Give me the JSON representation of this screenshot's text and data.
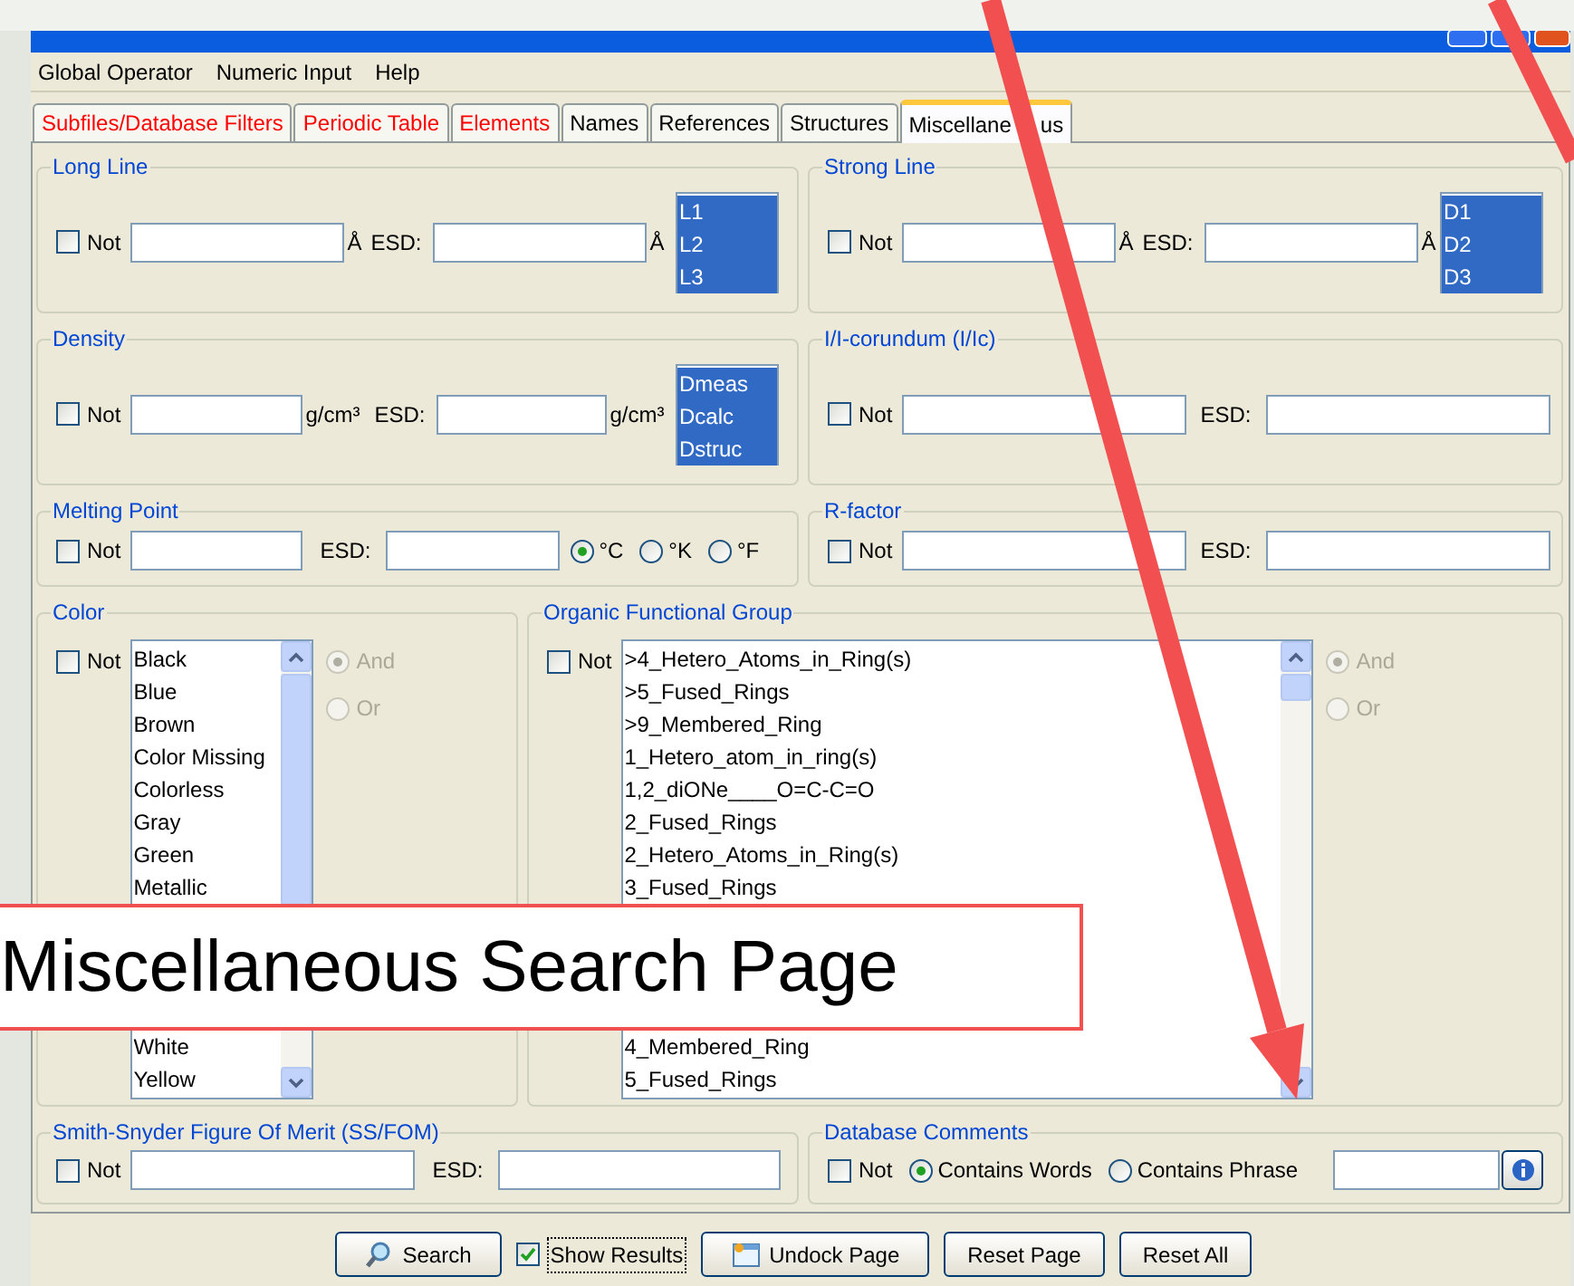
{
  "menu": [
    "Global Operator",
    "Numeric Input",
    "Help"
  ],
  "tabs": [
    {
      "label": "Subfiles/Database Filters",
      "selected": false,
      "flagged": true
    },
    {
      "label": "Periodic Table",
      "selected": false,
      "flagged": true
    },
    {
      "label": "Elements",
      "selected": false,
      "flagged": true
    },
    {
      "label": "Names",
      "selected": false,
      "flagged": false
    },
    {
      "label": "References",
      "selected": false,
      "flagged": false
    },
    {
      "label": "Structures",
      "selected": false,
      "flagged": false
    },
    {
      "label": "Miscellane",
      "label_after_cover": "us",
      "selected": true,
      "flagged": false
    }
  ],
  "long_line": {
    "title": "Long Line",
    "not": {
      "label": "Not",
      "checked": false
    },
    "unit": "Å",
    "esd_label": "ESD:",
    "esd_unit": "Å",
    "options": [
      {
        "label": "L1",
        "selected": true
      },
      {
        "label": "L2",
        "selected": true
      },
      {
        "label": "L3",
        "selected": true
      }
    ]
  },
  "strong_line": {
    "title": "Strong Line",
    "not": {
      "label": "Not",
      "checked": false
    },
    "unit": "Å",
    "esd_label": "ESD:",
    "esd_unit": "Å",
    "options": [
      {
        "label": "D1",
        "selected": true
      },
      {
        "label": "D2",
        "selected": true
      },
      {
        "label": "D3",
        "selected": true
      }
    ]
  },
  "density": {
    "title": "Density",
    "not": {
      "label": "Not",
      "checked": false
    },
    "unit": "g/cm³",
    "esd_label": "ESD:",
    "esd_unit": "g/cm³",
    "options": [
      {
        "label": "Dmeas",
        "selected": true
      },
      {
        "label": "Dcalc",
        "selected": true
      },
      {
        "label": "Dstruc",
        "selected": true
      }
    ]
  },
  "i_corundum": {
    "title": "I/I-corundum (I/Ic)",
    "not": {
      "label": "Not",
      "checked": false
    },
    "esd_label": "ESD:"
  },
  "melting_point": {
    "title": "Melting Point",
    "not": {
      "label": "Not",
      "checked": false
    },
    "esd_label": "ESD:",
    "units": [
      {
        "label": "°C",
        "selected": true
      },
      {
        "label": "°K",
        "selected": false
      },
      {
        "label": "°F",
        "selected": false
      }
    ]
  },
  "r_factor": {
    "title": "R-factor",
    "not": {
      "label": "Not",
      "checked": false
    },
    "esd_label": "ESD:"
  },
  "color": {
    "title": "Color",
    "not": {
      "label": "Not",
      "checked": false
    },
    "items_top": [
      "Black",
      "Blue",
      "Brown",
      "Color Missing",
      "Colorless",
      "Gray",
      "Green",
      "Metallic"
    ],
    "items_bottom": [
      "White",
      "Yellow"
    ],
    "operators": [
      {
        "label": "And",
        "selected": true,
        "disabled": true
      },
      {
        "label": "Or",
        "selected": false,
        "disabled": true
      }
    ]
  },
  "organic_functional_group": {
    "title": "Organic Functional Group",
    "not": {
      "label": "Not",
      "checked": false
    },
    "items_top": [
      ">4_Hetero_Atoms_in_Ring(s)",
      ">5_Fused_Rings",
      ">9_Membered_Ring",
      "1_Hetero_atom_in_ring(s)",
      "1,2_diONe____O=C-C=O",
      "2_Fused_Rings",
      "2_Hetero_Atoms_in_Ring(s)",
      "3_Fused_Rings"
    ],
    "items_bottom": [
      "4_Membered_Ring",
      "5_Fused_Rings"
    ],
    "operators": [
      {
        "label": "And",
        "selected": true,
        "disabled": true
      },
      {
        "label": "Or",
        "selected": false,
        "disabled": true
      }
    ]
  },
  "ss_fom": {
    "title": "Smith-Snyder Figure Of Merit (SS/FOM)",
    "not": {
      "label": "Not",
      "checked": false
    },
    "esd_label": "ESD:"
  },
  "database_comments": {
    "title": "Database Comments",
    "not": {
      "label": "Not",
      "checked": false
    },
    "modes": [
      {
        "label": "Contains Words",
        "selected": true
      },
      {
        "label": "Contains Phrase",
        "selected": false
      }
    ]
  },
  "buttons": [
    {
      "label": "Search",
      "kind": "search"
    },
    {
      "label": "Show Results",
      "kind": "checkbox",
      "checked": true
    },
    {
      "label": "Undock Page",
      "kind": "undock"
    },
    {
      "label": "Reset Page",
      "kind": "plain"
    },
    {
      "label": "Reset All",
      "kind": "plain"
    }
  ],
  "callout": {
    "text": "Miscellaneous Search Page"
  }
}
